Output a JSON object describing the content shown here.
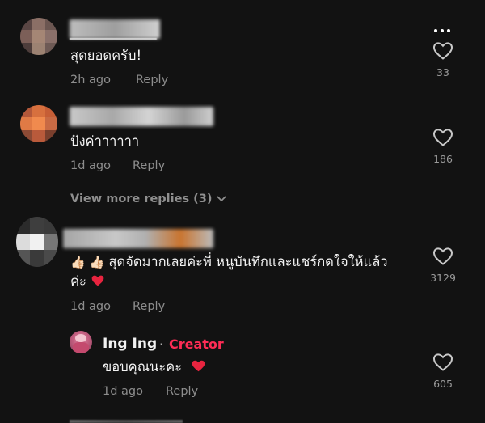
{
  "header": {
    "more_icon": "more-dots-icon"
  },
  "comments": [
    {
      "text": "สุดยอดครับ!",
      "time": "2h ago",
      "reply_label": "Reply",
      "likes": "33"
    },
    {
      "text": "ปังค่าาาาาา",
      "time": "1d ago",
      "reply_label": "Reply",
      "likes": "186",
      "view_more": "View more replies (3)"
    },
    {
      "text_line1": "สุดจัดมากเลยค่ะพี่ หนูบันทึกและแชร์กดใจให้แล้ว",
      "text_line2": "ค่ะ",
      "time": "1d ago",
      "reply_label": "Reply",
      "likes": "3129"
    }
  ],
  "creator_reply": {
    "name": "Ing Ing",
    "separator": "·",
    "badge": "Creator",
    "text": "ขอบคุณนะคะ",
    "time": "1d ago",
    "reply_label": "Reply",
    "likes": "605"
  },
  "colors": {
    "background": "#121212",
    "accent": "#fe2c55",
    "secondary_text": "#8d8d8d"
  }
}
